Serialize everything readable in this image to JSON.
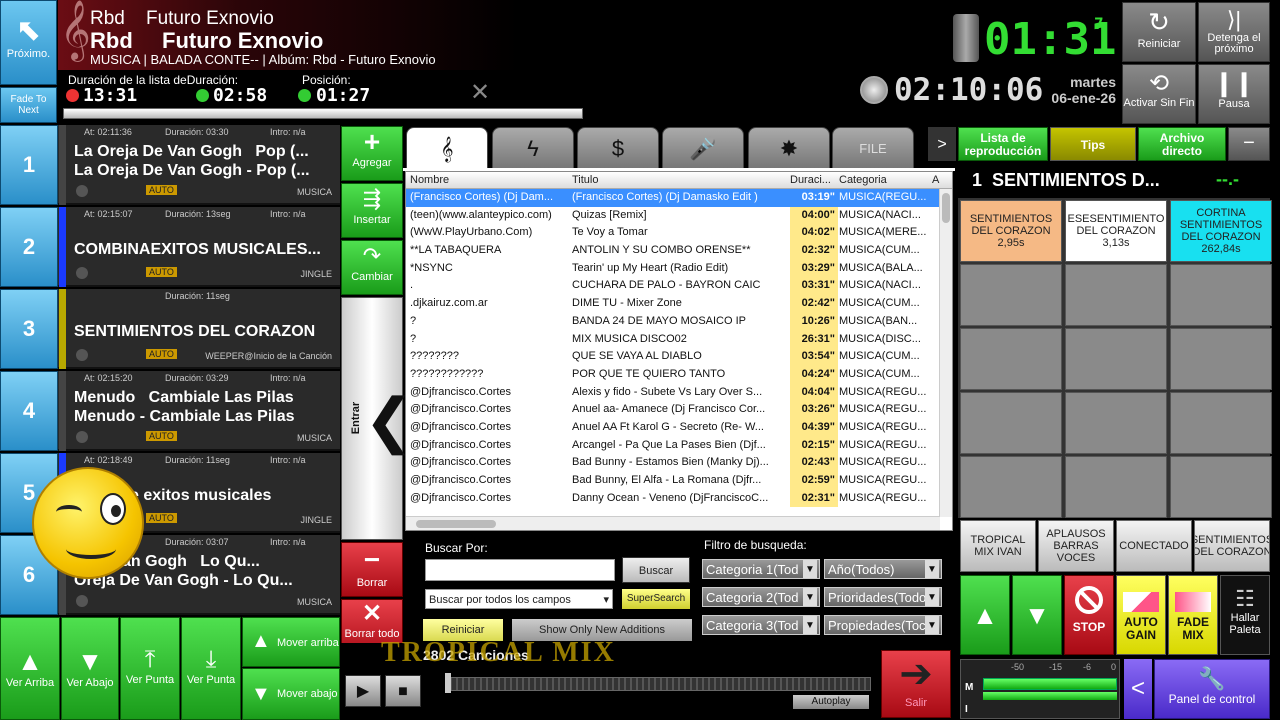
{
  "top": {
    "next_label": "Próximo.",
    "fade_label": "Fade To Next",
    "track_small": "Rbd    Futuro Exnovio",
    "artist": "Rbd",
    "title": "Futuro Exnovio",
    "meta": "MUSICA | BALADA CONTE-- | Albúm: Rbd - Futuro Exnovio",
    "dur_list_label": "Duración de la lista deDuración:",
    "pos_label": "Posición:",
    "dur_list": "13:31",
    "duration": "02:58",
    "position": "01:27",
    "big_clock": "01:31",
    "big_clock_sup": "7",
    "time": "02:10:06",
    "weekday": "martes",
    "date": "06-ene-26"
  },
  "controls": {
    "reiniciar": "Reiniciar",
    "detenga": "Detenga el próximo",
    "activar": "Activar Sin Fin",
    "pausa": "Pausa"
  },
  "queue": [
    {
      "num": "1",
      "at": "At: 02:11:36",
      "dur": "Duración: 03:30",
      "intro": "Intro: n/a",
      "line1": "La Oreja De Van Gogh   Pop (...",
      "line2": "La Oreja De Van Gogh - Pop (...",
      "mode": "AUTO",
      "cat": "MUSICA",
      "bar": "#444"
    },
    {
      "num": "2",
      "at": "At: 02:15:07",
      "dur": "Duración: 13seg",
      "intro": "Intro: n/a",
      "line1": "COMBINAEXITOS MUSICALES...",
      "line2": "",
      "mode": "AUTO",
      "cat": "JINGLE",
      "bar": "#1a3aff"
    },
    {
      "num": "3",
      "at": "",
      "dur": "Duración: 11seg",
      "intro": "",
      "line1": "SENTIMIENTOS DEL CORAZON",
      "line2": "",
      "mode": "AUTO",
      "cat": "WEEPER@Inicio de la Canción",
      "bar": "#b8a800"
    },
    {
      "num": "4",
      "at": "At: 02:15:20",
      "dur": "Duración: 03:29",
      "intro": "Intro: n/a",
      "line1": "Menudo   Cambiale Las Pilas",
      "line2": "Menudo - Cambiale Las Pilas",
      "mode": "AUTO",
      "cat": "MUSICA",
      "bar": "#444"
    },
    {
      "num": "5",
      "at": "At: 02:18:49",
      "dur": "Duración: 11seg",
      "intro": "Intro: n/a",
      "line1": "acion de exitos musicales",
      "line2": "",
      "mode": "AUTO",
      "cat": "JINGLE",
      "bar": "#1a3aff"
    },
    {
      "num": "6",
      "at": "At: 02:19:01",
      "dur": "Duración: 03:07",
      "intro": "Intro: n/a",
      "line1": "a De Van Gogh   Lo Qu...",
      "line2": "Oreja De Van Gogh - Lo Qu...",
      "mode": "",
      "cat": "MUSICA",
      "bar": "#444"
    }
  ],
  "side": {
    "agregar": "Agregar",
    "insertar": "Insertar",
    "cambiar": "Cambiar",
    "entrar": "Entrar",
    "borrar": "Borrar",
    "borrar_todo": "Borrar todo"
  },
  "tabs": [
    "𝄞",
    "ϟ",
    "$",
    "🎤",
    "✸",
    "FILE"
  ],
  "table": {
    "headers": [
      "Nombre",
      "Titulo",
      "Duraci...",
      "Categoria",
      "A"
    ],
    "rows": [
      [
        "(Francisco Cortes) (Dj Dam...",
        "(Francisco Cortes) (Dj Damasko Edit )",
        "03:19\"",
        "MUSICA(REGU..."
      ],
      [
        "(teen)(www.alanteypico.com)",
        "Quizas [Remix]",
        "04:00\"",
        "MUSICA(NACI..."
      ],
      [
        "(WwW.PlayUrbano.Com)",
        "Te Voy a Tomar",
        "04:02\"",
        "MUSICA(MERE..."
      ],
      [
        "**LA TABAQUERA",
        "ANTOLIN Y SU COMBO ORENSE**",
        "02:32\"",
        "MUSICA(CUM..."
      ],
      [
        "*NSYNC",
        "Tearin' up My Heart (Radio Edit)",
        "03:29\"",
        "MUSICA(BALA..."
      ],
      [
        ".",
        "CUCHARA DE PALO - BAYRON CAIC",
        "03:31\"",
        "MUSICA(NACI..."
      ],
      [
        ".djkairuz.com.ar",
        "DIME TU - Mixer Zone",
        "02:42\"",
        "MUSICA(CUM..."
      ],
      [
        "?",
        "BANDA 24 DE MAYO MOSAICO IP",
        "10:26\"",
        "MUSICA(BAN..."
      ],
      [
        "?",
        "MIX MUSICA DISCO02",
        "26:31\"",
        "MUSICA(DISC..."
      ],
      [
        "????????",
        "QUE SE VAYA AL DIABLO",
        "03:54\"",
        "MUSICA(CUM..."
      ],
      [
        "????????????",
        "POR QUE TE QUIERO TANTO",
        "04:24\"",
        "MUSICA(CUM..."
      ],
      [
        "@Djfrancisco.Cortes",
        "Alexis y fido - Subete Vs Lary Over S...",
        "04:04\"",
        "MUSICA(REGU..."
      ],
      [
        "@Djfrancisco.Cortes",
        "Anuel aa- Amanece (Dj Francisco Cor...",
        "03:26\"",
        "MUSICA(REGU..."
      ],
      [
        "@Djfrancisco.Cortes",
        "Anuel AA Ft Karol G - Secreto (Re- W...",
        "04:39\"",
        "MUSICA(REGU..."
      ],
      [
        "@Djfrancisco.Cortes",
        "Arcangel - Pa Que La Pases Bien (Djf...",
        "02:15\"",
        "MUSICA(REGU..."
      ],
      [
        "@Djfrancisco.Cortes",
        "Bad Bunny - Estamos Bien (Manky Dj)...",
        "02:43\"",
        "MUSICA(REGU..."
      ],
      [
        "@Djfrancisco.Cortes",
        "Bad Bunny, El Alfa - La Romana (Djfr...",
        "02:59\"",
        "MUSICA(REGU..."
      ],
      [
        "@Djfrancisco.Cortes",
        "Danny Ocean - Veneno (DjFranciscoC...",
        "02:31\"",
        "MUSICA(REGU..."
      ]
    ]
  },
  "search": {
    "buscar_por": "Buscar Por:",
    "buscar_btn": "Buscar",
    "mode": "Buscar por todos los campos",
    "supersearch": "SuperSearch",
    "reiniciar": "Reiniciar",
    "new_additions": "Show Only New Additions",
    "filtro": "Filtro de busqueda:",
    "cat1": "Categoria 1(Tod",
    "cat2": "Categoria 2(Tod",
    "cat3": "Categoria 3(Tod",
    "anio": "Año(Todos)",
    "prio": "Prioridades(Todo",
    "prop": "Propiedades(Toc"
  },
  "player": {
    "count": "2802 Canciones",
    "marquee": "TROPICAL MIX",
    "autoplay": "Autoplay",
    "salir": "Salir"
  },
  "bottom_left": {
    "ver_arriba": "Ver Arriba",
    "ver_abajo": "Ver Abajo",
    "ver_punta1": "Ver Punta",
    "ver_punta2": "Ver Punta",
    "mover_arriba": "Mover arriba",
    "mover_abajo": "Mover abajo"
  },
  "right": {
    "lista": "Lista de reproducción",
    "tips": "Tips",
    "archivo": "Archivo directo",
    "header": "1  SENTIMIENTOS D...",
    "header_tag": "--.-",
    "tiles": [
      {
        "name": "SENTIMIENTOS DEL CORAZON",
        "time": "2,95s",
        "bg": "#f5b985"
      },
      {
        "name": "ESESENTIMIENTO DEL CORAZON",
        "time": "3,13s",
        "bg": "#ffffff"
      },
      {
        "name": "CORTINA SENTIMIENTOS DEL CORAZON",
        "time": "262,84s",
        "bg": "#18e0f0"
      }
    ],
    "pads": [
      "TROPICAL MIX IVAN",
      "APLAUSOS BARRAS VOCES",
      "CONECTADO",
      "SENTIMIENTOS DEL CORAZON"
    ],
    "stop": "STOP",
    "autogain": "AUTO GAIN",
    "fademix": "FADE MIX",
    "hallar": "Hallar Paleta",
    "panel": "Panel de control",
    "meter_ticks": [
      "-50",
      "-15",
      "-6",
      "0"
    ]
  }
}
